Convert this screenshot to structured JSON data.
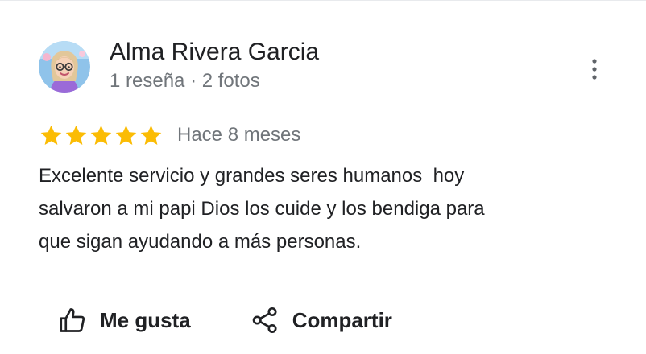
{
  "review": {
    "author": {
      "name": "Alma Rivera Garcia",
      "meta": "1 reseña · 2 fotos",
      "avatar_icon": "profile-avatar-icon"
    },
    "rating": {
      "stars": 5,
      "max_stars": 5,
      "star_color": "#fbbc04",
      "date": "Hace 8 meses"
    },
    "text": "Excelente servicio y grandes seres humanos  hoy\nsalvaron a mi papi Dios los cuide y los bendiga para\nque sigan ayudando a más personas."
  },
  "menu": {
    "more_icon": "more-vert-icon"
  },
  "actions": {
    "like_label": "Me gusta",
    "like_icon": "thumb-up-icon",
    "share_label": "Compartir",
    "share_icon": "share-icon"
  },
  "colors": {
    "primary_text": "#202124",
    "secondary_text": "#70757a",
    "star": "#fbbc04"
  }
}
